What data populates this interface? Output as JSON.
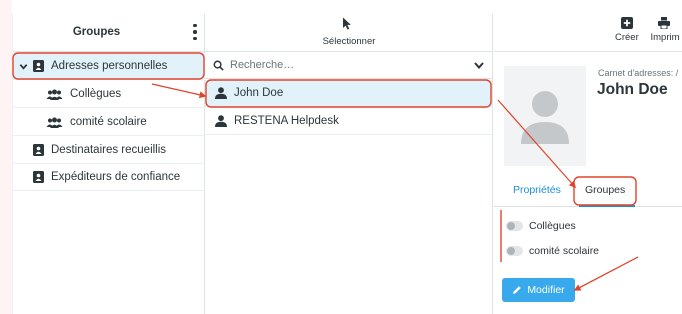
{
  "groups_pane": {
    "title": "Groupes",
    "items": [
      {
        "label": "Adresses personnelles",
        "icon": "address-book-icon",
        "expanded": true,
        "selected": true
      },
      {
        "label": "Collègues",
        "icon": "group-icon",
        "child": true
      },
      {
        "label": "comité scolaire",
        "icon": "group-icon",
        "child": true
      },
      {
        "label": "Destinataires recueillis",
        "icon": "address-book-icon"
      },
      {
        "label": "Expéditeurs de confiance",
        "icon": "address-book-icon"
      }
    ]
  },
  "list_pane": {
    "select_label": "Sélectionner",
    "search_placeholder": "Recherche…",
    "contacts": [
      {
        "name": "John Doe",
        "icon": "user-icon",
        "selected": true
      },
      {
        "name": "RESTENA Helpdesk",
        "icon": "user-icon"
      }
    ]
  },
  "detail_pane": {
    "toolbar": {
      "create_label": "Créer",
      "print_label": "Imprim"
    },
    "address_book_label": "Carnet d'adresses: /",
    "contact_name": "John Doe",
    "tabs": {
      "properties": "Propriétés",
      "groups": "Groupes"
    },
    "group_toggles": [
      {
        "label": "Collègues",
        "checked": false
      },
      {
        "label": "comité scolaire",
        "checked": false
      }
    ],
    "edit_button": "Modifier"
  },
  "colors": {
    "accent": "#37a9ec",
    "selection": "#e2f2fb",
    "annotation": "#e1442c",
    "text": "#2c363a"
  }
}
